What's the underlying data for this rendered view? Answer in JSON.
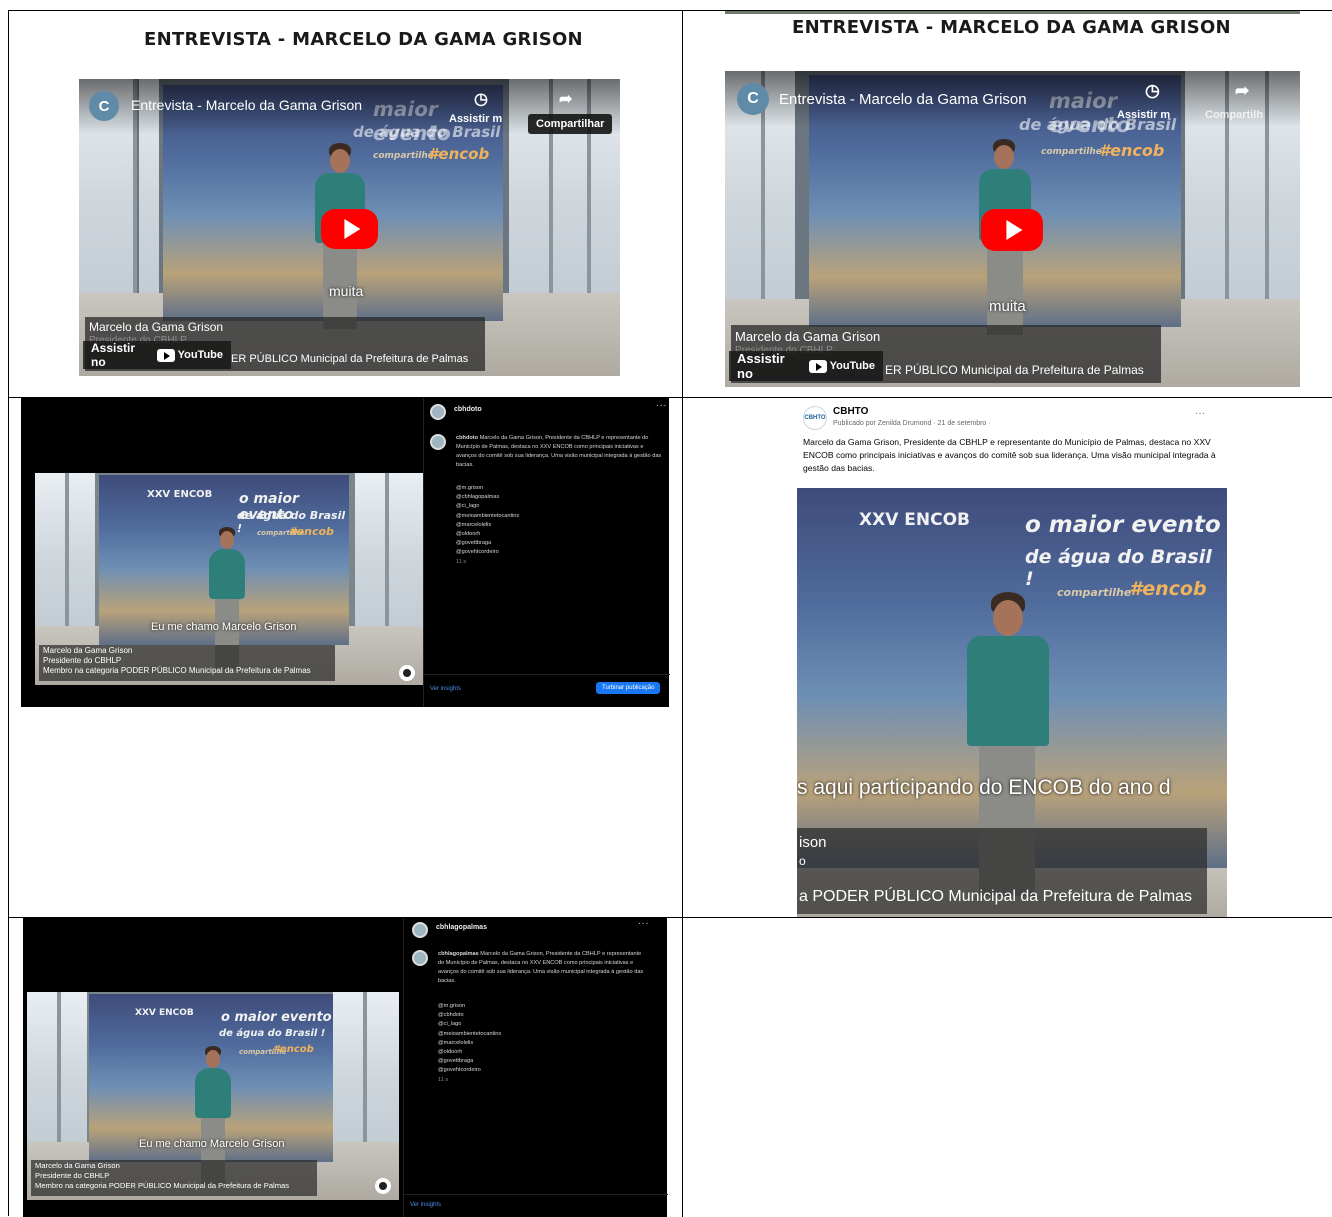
{
  "cells": {
    "youtube_1": {
      "heading": "ENTREVISTA - MARCELO DA GAMA GRISON",
      "channel_initial": "C",
      "video_title": "Entrevista - Marcelo da Gama Grison",
      "watch_later_label": "Assistir m",
      "share_label": "Compartilhar",
      "banner_line1": "maior evento",
      "banner_line2": "de água do Brasil",
      "banner_tag": "#encob",
      "banner_small": "compartilhe",
      "subtitle": "muita",
      "caption_name": "Marcelo da Gama Grison",
      "caption_line2": "Presidente do CBHLP",
      "caption_line3": "ER PÚBLICO Municipal da Prefeitura de Palmas",
      "watch_on": "Assistir no",
      "youtube_logo_text": "YouTube"
    },
    "youtube_2": {
      "heading": "ENTREVISTA - MARCELO DA GAMA GRISON",
      "channel_initial": "C",
      "video_title": "Entrevista - Marcelo da Gama Grison",
      "watch_later_label": "Assistir m",
      "share_label": "Compartilh",
      "banner_line1": "maior evento",
      "banner_line2": "de água do Brasil",
      "banner_tag": "#encob",
      "banner_small": "compartilhe",
      "subtitle": "muita",
      "caption_name": "Marcelo da Gama Grison",
      "caption_line2": "Presidente do CBHLP",
      "caption_line3": "ER PÚBLICO Municipal da Prefeitura de Palmas",
      "watch_on": "Assistir no",
      "youtube_logo_text": "YouTube"
    },
    "instagram_1": {
      "username_top": "cbhdoto",
      "username_caption": "cbhdoto",
      "caption": "Marcelo da Gama Grison, Presidente da CBHLP e representante do Município de Palmas, destaca no XXV ENCOB como principais iniciativas e avanços do comitê sob sua liderança. Uma visão municipal integrada à gestão das bacias.",
      "tags": [
        "@m.grison",
        "@cbhlagopalmas",
        "@ci_lago",
        "@meioambientetocantins",
        "@marcelolelis",
        "@oldoorh",
        "@govettbraga",
        "@govehtcordeiro"
      ],
      "time": "11 s",
      "insights_label": "Ver insights",
      "boost_label": "Turbinar publicação",
      "banner_title": "XXV ENCOB",
      "banner_line1": "o maior evento",
      "banner_line2": "de água do Brasil !",
      "banner_tag": "#encob",
      "banner_small": "compartilhe",
      "subtitle": "Eu me chamo Marcelo Grison",
      "lower_third": [
        "Marcelo da Gama Grison",
        "Presidente do CBHLP",
        "Membro na categoria PODER PÚBLICO Municipal da Prefeitura de Palmas"
      ],
      "more": "..."
    },
    "facebook": {
      "page_name": "CBHTO",
      "avatar_text": "CBHTO",
      "meta": "Publicado por Zenilda Drumond · 21 de setembro ·",
      "text": "Marcelo da Gama Grison, Presidente da CBHLP e representante do Município de Palmas, destaca no XXV ENCOB como principais iniciativas e avanços do comitê sob sua liderança. Uma visão municipal integrada à gestão das bacias.",
      "more": "···",
      "banner_title": "XXV ENCOB",
      "banner_line1": "o maior evento",
      "banner_line2": "de água do Brasil !",
      "banner_small": "compartilhe",
      "banner_tag": "#encob",
      "subtitle": "s aqui participando do ENCOB do ano d",
      "caption_line1": "ison",
      "caption_line2": "o",
      "caption_line3": "a PODER PÚBLICO Municipal da Prefeitura de Palmas"
    },
    "instagram_2": {
      "username_top": "cbhlagopalmas",
      "username_caption": "cbhlagopalmas",
      "caption": "Marcelo da Gama Grison, Presidente da CBHLP e representante do Município de Palmas, destaca no XXV ENCOB como principais iniciativas e avanços do comitê sob sua liderança. Uma visão municipal integrada à gestão das bacias.",
      "tags": [
        "@m.grison",
        "@cbhdoto",
        "@ci_lago",
        "@meioambientetocantins",
        "@marcelolelis",
        "@oldoorh",
        "@govettbraga",
        "@govehtcordeiro"
      ],
      "time": "11 s",
      "insights_label": "Ver insights",
      "banner_title": "XXV ENCOB",
      "banner_line1": "o maior evento",
      "banner_line2": "de água do Brasil !",
      "banner_tag": "#encob",
      "banner_small": "compartilhe",
      "subtitle": "Eu me chamo Marcelo Grison",
      "lower_third": [
        "Marcelo da Gama Grison",
        "Presidente do CBHLP",
        "Membro na categoria PODER PÚBLICO Municipal da Prefeitura de Palmas"
      ],
      "more": "..."
    }
  },
  "colors": {
    "youtube_red": "#ff0000",
    "facebook_blue": "#1877f2",
    "instagram_link": "#4a8ee8",
    "banner_tag": "#f0b25a",
    "shirt": "#2e7f7a"
  }
}
